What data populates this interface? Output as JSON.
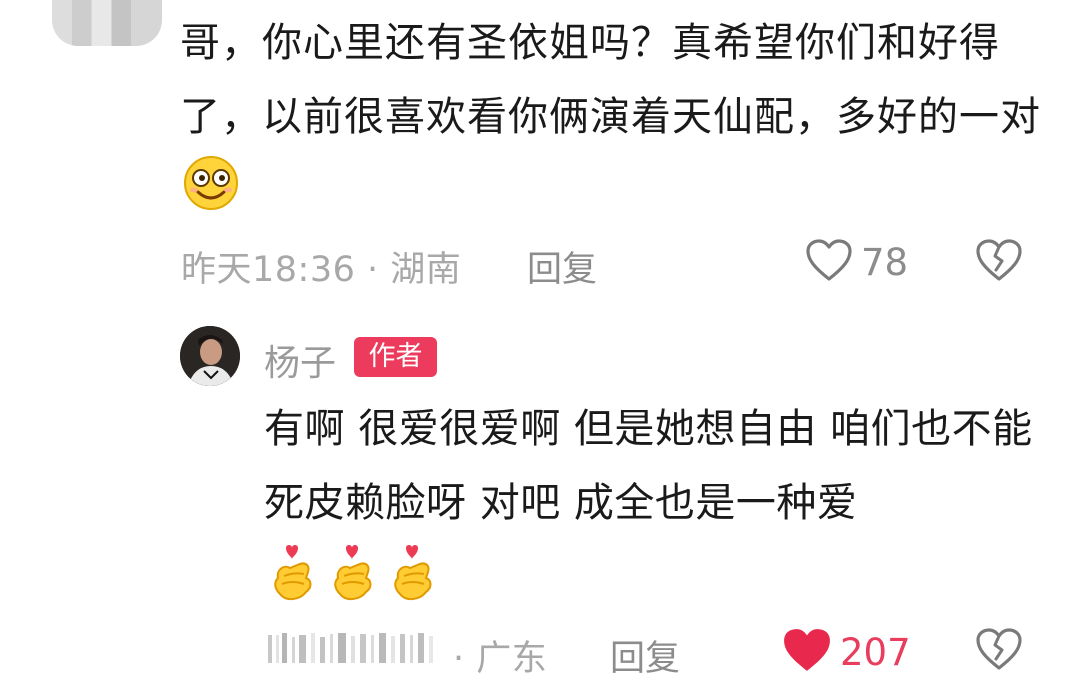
{
  "top_comment": {
    "text": "哥，你心里还有圣依姐吗？真希望你们和好得了，以前很喜欢看你俩演着天仙配，多好的一对",
    "meta": "昨天18:36 · 湖南",
    "reply_label": "回复",
    "likes": "78",
    "like_icon": "heart-outline-icon",
    "dislike_icon": "broken-heart-icon"
  },
  "reply": {
    "username": "杨子",
    "badge": "作者",
    "text": "有啊 很爱很爱啊 但是她想自由 咱们也不能死皮赖脸呀 对吧 成全也是一种爱",
    "hand_emoji_icon": "finger-heart-icon",
    "location": "· 广东",
    "reply_label": "回复",
    "likes": "207",
    "like_icon": "heart-filled-icon",
    "dislike_icon": "broken-heart-icon"
  },
  "colors": {
    "accent_red": "#ec3b5d",
    "text_primary": "#1a1a1a",
    "text_secondary": "#a8a8a8"
  }
}
